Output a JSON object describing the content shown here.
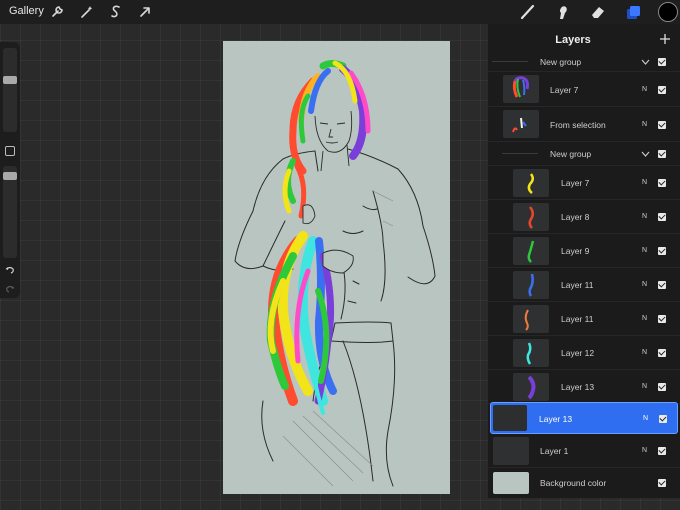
{
  "topbar": {
    "gallery_label": "Gallery",
    "left_tools": [
      "wrench-icon",
      "magic-wand-icon",
      "selection-s-icon",
      "transform-arrow-icon"
    ],
    "right_tools": [
      "brush-icon",
      "smudge-icon",
      "eraser-icon",
      "layers-icon"
    ],
    "active_color": "#000000"
  },
  "colors": {
    "accent": "#2f6ef0",
    "panel": "#1b1b1b",
    "canvas": "#b8c5c1"
  },
  "layers_panel": {
    "title": "Layers",
    "rows": [
      {
        "type": "group",
        "name": "New group",
        "visible": true,
        "expanded": true
      },
      {
        "type": "layer",
        "name": "Layer 7",
        "blend": "N",
        "visible": true,
        "thumb": "multicolor-hair"
      },
      {
        "type": "layer",
        "name": "From selection",
        "blend": "N",
        "visible": true,
        "thumb": "selection"
      },
      {
        "type": "group",
        "name": "New group",
        "visible": true,
        "expanded": true
      },
      {
        "type": "layer",
        "name": "Layer 7",
        "blend": "N",
        "visible": true,
        "thumb_color": "#f2e419"
      },
      {
        "type": "layer",
        "name": "Layer 8",
        "blend": "N",
        "visible": true,
        "thumb_color": "#e8452f"
      },
      {
        "type": "layer",
        "name": "Layer 9",
        "blend": "N",
        "visible": true,
        "thumb_color": "#2dc93a"
      },
      {
        "type": "layer",
        "name": "Layer 11",
        "blend": "N",
        "visible": true,
        "thumb_color": "#3b6ff2"
      },
      {
        "type": "layer",
        "name": "Layer 11",
        "blend": "N",
        "visible": true,
        "thumb_color": "#f07a3a"
      },
      {
        "type": "layer",
        "name": "Layer 12",
        "blend": "N",
        "visible": true,
        "thumb_color": "#3fe6e0"
      },
      {
        "type": "layer",
        "name": "Layer 13",
        "blend": "N",
        "visible": true,
        "thumb_color": "#7a3fd9"
      },
      {
        "type": "layer",
        "name": "Layer 13",
        "blend": "N",
        "visible": true,
        "selected": true
      },
      {
        "type": "layer",
        "name": "Layer 1",
        "blend": "N",
        "visible": true
      },
      {
        "type": "background",
        "name": "Background color",
        "visible": true,
        "swatch": "#b8c5c1"
      }
    ]
  }
}
